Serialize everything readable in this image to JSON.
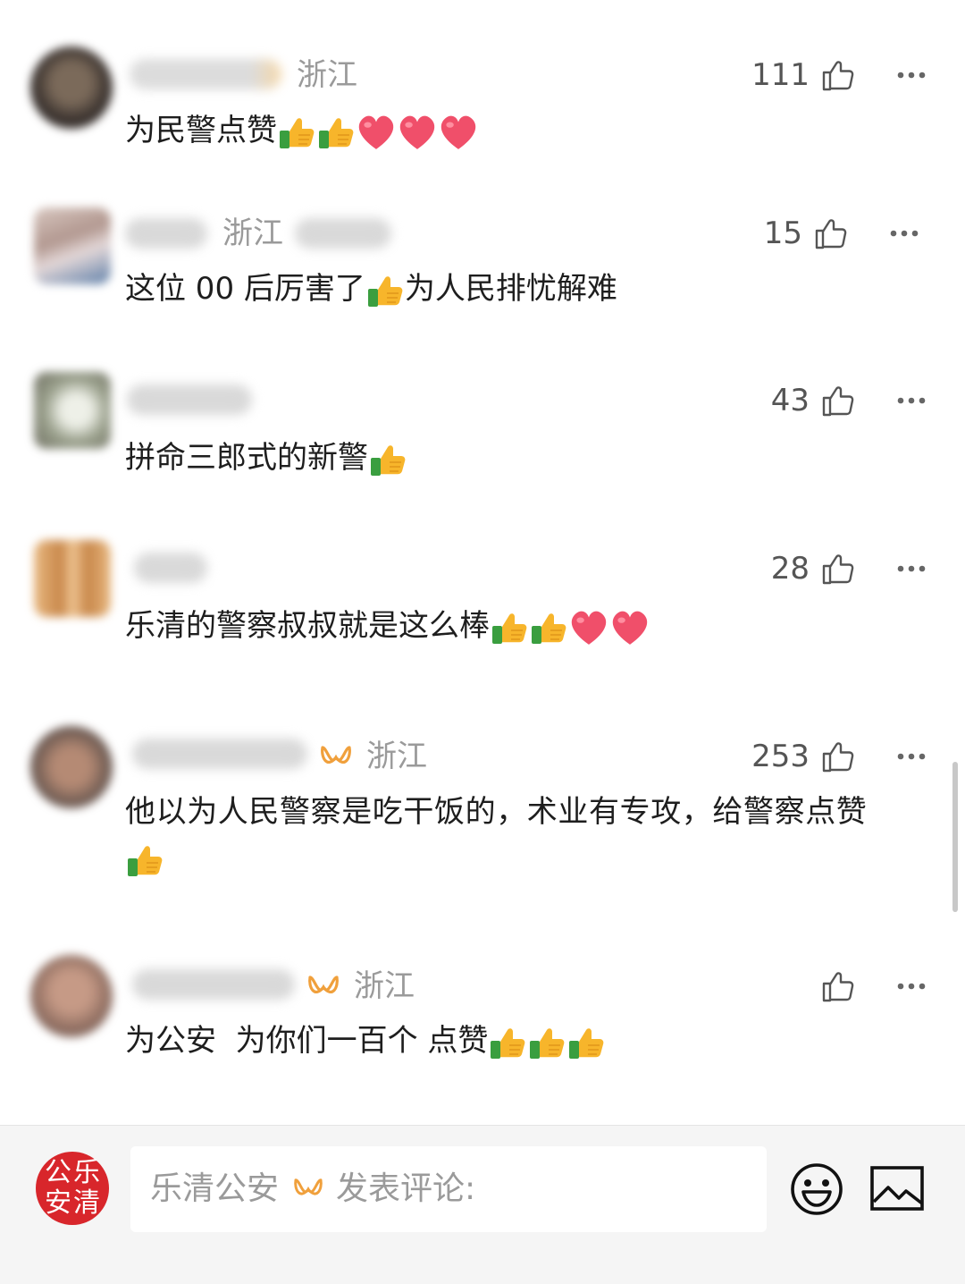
{
  "comments": [
    {
      "region": "浙江",
      "likes": "111",
      "text": "为民警点赞",
      "emoji": [
        "thumb",
        "thumb",
        "heart",
        "heart",
        "heart"
      ]
    },
    {
      "region": "浙江",
      "likes": "15",
      "text": "这位 00 后厉害了",
      "text_after": "为人民排忧解难",
      "emoji": [
        "thumb"
      ]
    },
    {
      "region": "",
      "likes": "43",
      "text": "拼命三郎式的新警",
      "emoji": [
        "thumb"
      ]
    },
    {
      "region": "",
      "likes": "28",
      "text": "乐清的警察叔叔就是这么棒",
      "emoji": [
        "thumb",
        "thumb",
        "heart",
        "heart"
      ]
    },
    {
      "region": "浙江",
      "likes": "253",
      "text": "他以为人民警察是吃干饭的，术业有专攻，给警察点赞",
      "emoji": [
        "thumb"
      ]
    },
    {
      "region": "浙江",
      "likes": "",
      "text": "为公安  为你们一百个 点赞",
      "emoji": [
        "thumb",
        "thumb",
        "thumb"
      ]
    }
  ],
  "footer": {
    "logo_chars": [
      "公",
      "乐",
      "安",
      "清"
    ],
    "input_prefix": "乐清公安",
    "input_suffix": "发表评论:"
  },
  "colors": {
    "logo_red": "#d8262b",
    "vip_gold": "#f0a03c",
    "heart": "#f04f6a",
    "thumb_yellow": "#f7b52b",
    "thumb_green": "#3a9e3f"
  }
}
